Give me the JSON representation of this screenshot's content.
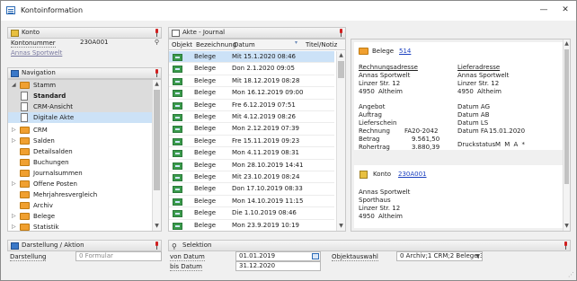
{
  "window": {
    "title": "Kontoinformation",
    "minimize": "—",
    "close": "✕"
  },
  "konto": {
    "header": "Konto",
    "field_label": "Kontonummer",
    "field_value": "230A001",
    "name_link": "Annas Sportwelt"
  },
  "navigation": {
    "header": "Navigation",
    "items": [
      {
        "label": "Stamm",
        "type": "folder",
        "expanded": true
      },
      {
        "label": "Standard",
        "type": "doc",
        "bold": true
      },
      {
        "label": "CRM-Ansicht",
        "type": "doc"
      },
      {
        "label": "Digitale Akte",
        "type": "doc",
        "selected": true
      },
      {
        "label": "CRM",
        "type": "folder"
      },
      {
        "label": "Salden",
        "type": "folder"
      },
      {
        "label": "Detailsalden",
        "type": "folder"
      },
      {
        "label": "Buchungen",
        "type": "folder"
      },
      {
        "label": "Journalsummen",
        "type": "folder"
      },
      {
        "label": "Offene Posten",
        "type": "folder"
      },
      {
        "label": "Mehrjahresvergleich",
        "type": "folder"
      },
      {
        "label": "Archiv",
        "type": "folder"
      },
      {
        "label": "Belege",
        "type": "folder"
      },
      {
        "label": "Statistik",
        "type": "folder"
      }
    ]
  },
  "darstellung": {
    "header": "Darstellung / Aktion",
    "label": "Darstellung",
    "value": "0 Formular"
  },
  "journal": {
    "header": "Akte - Journal",
    "columns": [
      "Objekt",
      "Bezeichnung",
      "Datum",
      "Titel/Notiz"
    ],
    "rows": [
      {
        "bez": "Belege",
        "datum": "Mit 15.1.2020 08:46"
      },
      {
        "bez": "Belege",
        "datum": "Don 2.1.2020 09:05"
      },
      {
        "bez": "Belege",
        "datum": "Mit 18.12.2019 08:28"
      },
      {
        "bez": "Belege",
        "datum": "Mon 16.12.2019 09:00"
      },
      {
        "bez": "Belege",
        "datum": "Fre 6.12.2019 07:51"
      },
      {
        "bez": "Belege",
        "datum": "Mit 4.12.2019 08:26"
      },
      {
        "bez": "Belege",
        "datum": "Mon 2.12.2019 07:39"
      },
      {
        "bez": "Belege",
        "datum": "Fre 15.11.2019 09:23"
      },
      {
        "bez": "Belege",
        "datum": "Mon 4.11.2019 08:31"
      },
      {
        "bez": "Belege",
        "datum": "Mon 28.10.2019 14:41"
      },
      {
        "bez": "Belege",
        "datum": "Mit 23.10.2019 08:24"
      },
      {
        "bez": "Belege",
        "datum": "Don 17.10.2019 08:33"
      },
      {
        "bez": "Belege",
        "datum": "Mon 14.10.2019 11:15"
      },
      {
        "bez": "Belege",
        "datum": "Die 1.10.2019 08:46"
      },
      {
        "bez": "Belege",
        "datum": "Mon 23.9.2019 10:19"
      }
    ]
  },
  "detail": {
    "belege_label": "Belege",
    "belege_link": "514",
    "rechnungsadresse_title": "Rechnungsadresse",
    "rechnungsadresse": [
      "Annas Sportwelt",
      "Linzer Str. 12",
      "4950",
      "Altheim"
    ],
    "lieferadresse_title": "Lieferadresse",
    "lieferadresse": [
      "Annas Sportwelt",
      "Linzer Str. 12",
      "4950",
      "Altheim"
    ],
    "left_fields": [
      {
        "label": "Angebot",
        "value": ""
      },
      {
        "label": "Auftrag",
        "value": ""
      },
      {
        "label": "Lieferschein",
        "value": ""
      },
      {
        "label": "Rechnung",
        "value": "FA20-2042"
      },
      {
        "label": "Betrag",
        "value": "9.561,50"
      },
      {
        "label": "Rohertrag",
        "value": "3.880,39"
      }
    ],
    "right_fields": [
      {
        "label": "Datum AG",
        "value": ""
      },
      {
        "label": "Datum AB",
        "value": ""
      },
      {
        "label": "Datum LS",
        "value": ""
      },
      {
        "label": "Datum FA",
        "value": "15.01.2020"
      }
    ],
    "druckstatus_label": "Druckstatus",
    "druckstatus_value": "M M A *",
    "konto_label": "Konto",
    "konto_link": "230A001",
    "konto_address": [
      "Annas Sportwelt",
      "Sporthaus",
      "Linzer Str. 12",
      "4950",
      "Altheim"
    ]
  },
  "selektion": {
    "header": "Selektion",
    "von_label": "von Datum",
    "von_value": "01.01.2019",
    "bis_label": "bis Datum",
    "bis_value": "31.12.2020",
    "objekt_label": "Objektauswahl",
    "objekt_value": "0 Archiv;1 CRM;2 Belege;3 P"
  }
}
